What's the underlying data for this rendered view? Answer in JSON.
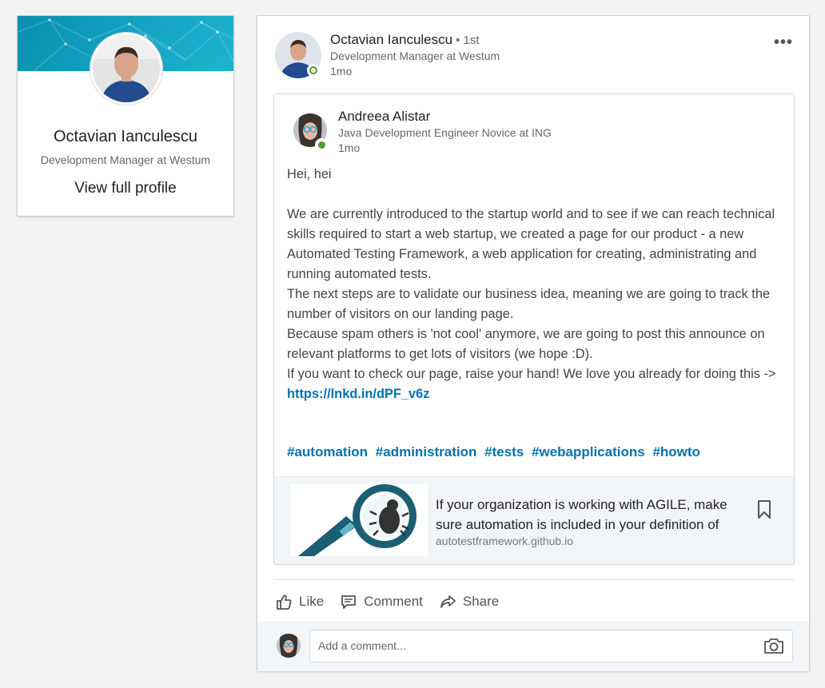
{
  "sidebar_profile": {
    "name": "Octavian Ianculescu",
    "headline": "Development Manager at Westum",
    "view_profile_label": "View full profile"
  },
  "post": {
    "author": {
      "name": "Octavian Ianculescu",
      "degree": "• 1st",
      "headline": "Development Manager at Westum",
      "time": "1mo"
    },
    "more_menu": "•••",
    "shared": {
      "author": {
        "name": "Andreea Alistar",
        "headline": "Java Development Engineer Novice at ING",
        "time": "1mo"
      },
      "body_intro": "Hei, hei",
      "body_lines": [
        "We are currently introduced to the startup world and to see if we can reach technical skills required to start a web startup, we created a page for our product - a new Automated Testing Framework, a web application for creating, administrating and running automated tests.",
        "The next steps are to validate our business idea, meaning we are going to track the number of visitors on our landing page.",
        "Because spam others is 'not cool' anymore, we are going to post this announce on relevant platforms to get lots of visitors (we hope :D)."
      ],
      "body_last_prefix": "If you want to check our page, raise your hand! We love you already for doing this -> ",
      "link_text": "https://lnkd.in/dPF_v6z",
      "hashtags": [
        "#automation",
        "#administration",
        "#tests",
        "#webapplications",
        "#howto"
      ],
      "preview": {
        "title": "If your organization is working with AGILE, make sure automation is included in your definition of done",
        "source": "autotestframework.github.io"
      }
    },
    "actions": {
      "like": "Like",
      "comment": "Comment",
      "share": "Share"
    },
    "comment_placeholder": "Add a comment..."
  },
  "colors": {
    "link": "#0073b1",
    "online": "#4c9c2e",
    "banner": "#12a3c2"
  },
  "icons": [
    "online-status-icon",
    "more-menu-icon",
    "bookmark-icon",
    "like-icon",
    "comment-icon",
    "share-icon",
    "camera-icon"
  ]
}
